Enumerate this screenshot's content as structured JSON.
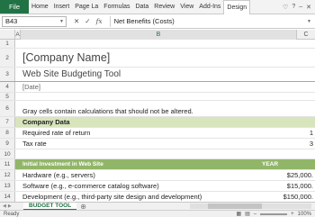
{
  "ribbon": {
    "file_tab": "File",
    "tabs": [
      "Home",
      "Insert",
      "Page La",
      "Formulas",
      "Data",
      "Review",
      "View",
      "Add-Ins",
      "Design"
    ]
  },
  "formula_bar": {
    "name_box": "B43",
    "formula": "Net Benefits (Costs)"
  },
  "columns": [
    "A",
    "B",
    "C"
  ],
  "sheet": {
    "company": "[Company Name]",
    "title": "Web Site Budgeting Tool",
    "date": "[Date]",
    "note": "Gray cells contain calculations that should not be altered.",
    "company_data_header": "Company Data",
    "required_rate_label": "Required rate of return",
    "required_rate_value": "1",
    "tax_rate_label": "Tax rate",
    "tax_rate_value": "3",
    "investment_header": "Initial Investment in Web Site",
    "year_header": "YEAR",
    "hardware_label": "Hardware (e.g., servers)",
    "hardware_value": "$25,000.",
    "software_label": "Software (e.g., e-commerce catalog software)",
    "software_value": "$15,000.",
    "development_label": "Development (e.g., third-party site design and development)",
    "development_value": "$150,000."
  },
  "sheet_tabs": {
    "active": "BUDGET TOOL"
  },
  "status": {
    "ready": "Ready",
    "zoom": "100%"
  }
}
